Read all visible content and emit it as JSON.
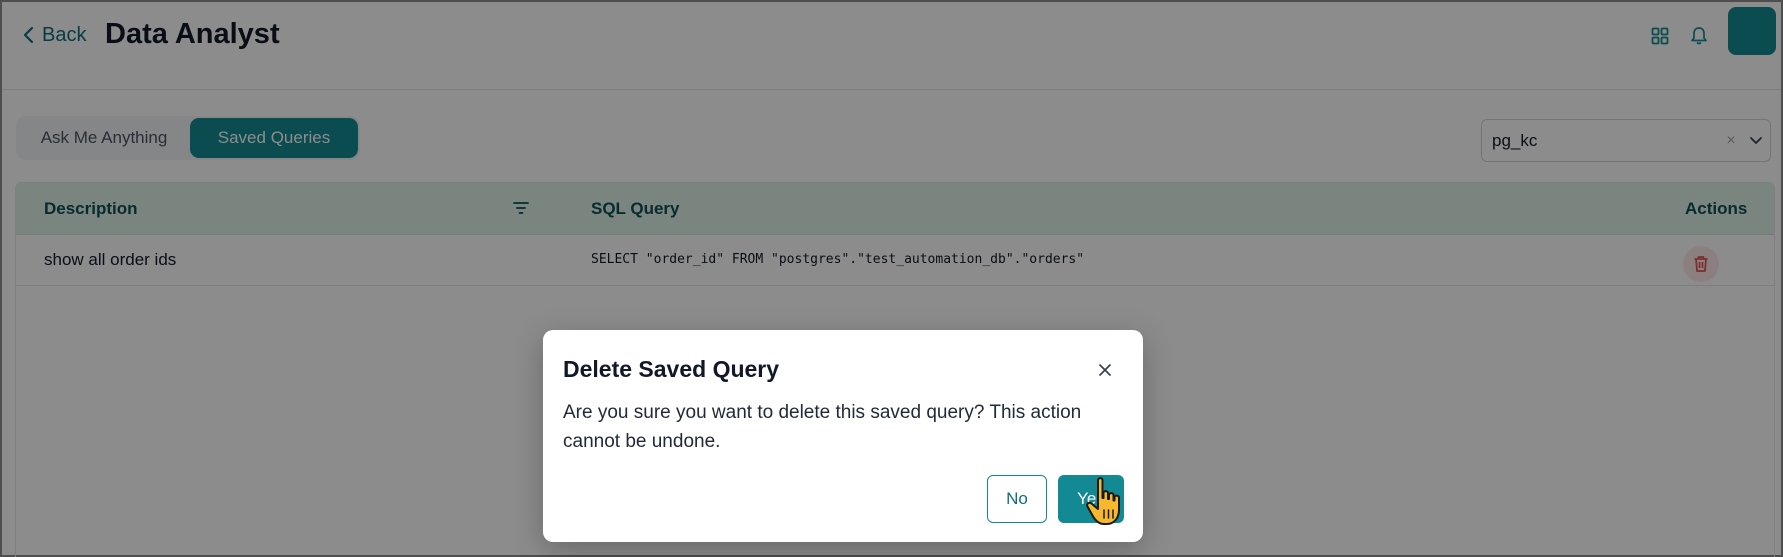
{
  "header": {
    "back_label": "Back",
    "title": "Data Analyst",
    "icons": [
      "grid-icon",
      "bell-icon"
    ]
  },
  "tabs": [
    {
      "label": "Ask Me Anything",
      "active": false
    },
    {
      "label": "Saved Queries",
      "active": true
    }
  ],
  "database_select": {
    "value": "pg_kc",
    "clear_glyph": "×"
  },
  "table": {
    "columns": [
      "Description",
      "SQL Query",
      "Actions"
    ],
    "rows": [
      {
        "description": "show all order ids",
        "sql": "SELECT \"order_id\" FROM \"postgres\".\"test_automation_db\".\"orders\""
      }
    ]
  },
  "modal": {
    "title": "Delete Saved Query",
    "message": "Are you sure you want to delete this saved query? This action cannot be undone.",
    "no_label": "No",
    "yes_label": "Yes",
    "close_glyph": "×"
  },
  "colors": {
    "accent": "#138a93",
    "header_row_bg": "#dff3ea",
    "delete_red": "#e05252"
  }
}
